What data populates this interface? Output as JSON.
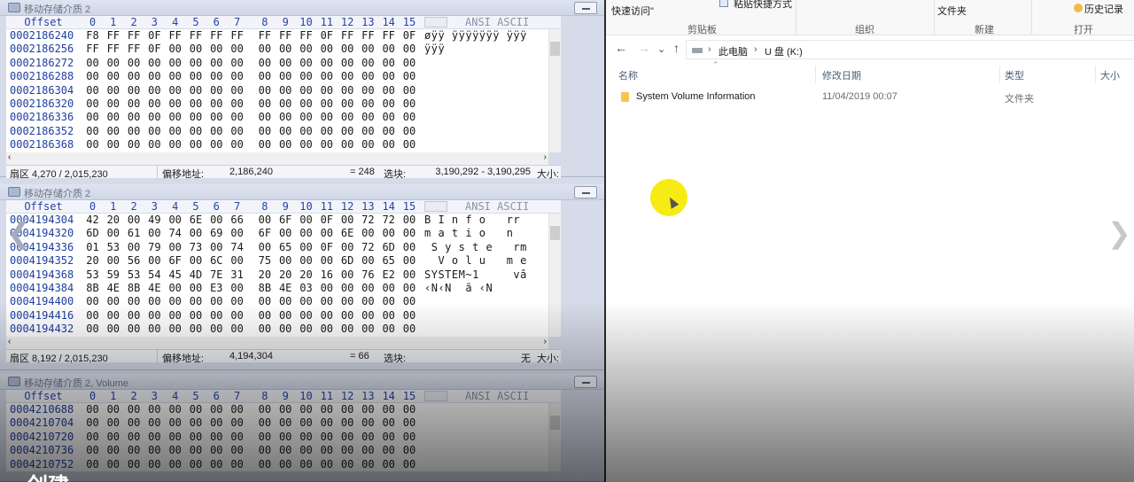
{
  "hex_editor": {
    "columns": [
      "0",
      "1",
      "2",
      "3",
      "4",
      "5",
      "6",
      "7",
      "8",
      "9",
      "10",
      "11",
      "12",
      "13",
      "14",
      "15"
    ],
    "offset_header": "Offset",
    "ascii_header": "ANSI ASCII",
    "panes": [
      {
        "title": "移动存储介质 2",
        "rows": [
          {
            "offset": "0002186240",
            "bytes": [
              "F8",
              "FF",
              "FF",
              "0F",
              "FF",
              "FF",
              "FF",
              "FF",
              "FF",
              "FF",
              "FF",
              "0F",
              "FF",
              "FF",
              "FF",
              "0F"
            ],
            "ascii": "øÿÿ ÿÿÿÿÿÿÿ ÿÿÿ"
          },
          {
            "offset": "0002186256",
            "bytes": [
              "FF",
              "FF",
              "FF",
              "0F",
              "00",
              "00",
              "00",
              "00",
              "00",
              "00",
              "00",
              "00",
              "00",
              "00",
              "00",
              "00"
            ],
            "ascii": "ÿÿÿ"
          },
          {
            "offset": "0002186272",
            "bytes": [
              "00",
              "00",
              "00",
              "00",
              "00",
              "00",
              "00",
              "00",
              "00",
              "00",
              "00",
              "00",
              "00",
              "00",
              "00",
              "00"
            ],
            "ascii": ""
          },
          {
            "offset": "0002186288",
            "bytes": [
              "00",
              "00",
              "00",
              "00",
              "00",
              "00",
              "00",
              "00",
              "00",
              "00",
              "00",
              "00",
              "00",
              "00",
              "00",
              "00"
            ],
            "ascii": ""
          },
          {
            "offset": "0002186304",
            "bytes": [
              "00",
              "00",
              "00",
              "00",
              "00",
              "00",
              "00",
              "00",
              "00",
              "00",
              "00",
              "00",
              "00",
              "00",
              "00",
              "00"
            ],
            "ascii": ""
          },
          {
            "offset": "0002186320",
            "bytes": [
              "00",
              "00",
              "00",
              "00",
              "00",
              "00",
              "00",
              "00",
              "00",
              "00",
              "00",
              "00",
              "00",
              "00",
              "00",
              "00"
            ],
            "ascii": ""
          },
          {
            "offset": "0002186336",
            "bytes": [
              "00",
              "00",
              "00",
              "00",
              "00",
              "00",
              "00",
              "00",
              "00",
              "00",
              "00",
              "00",
              "00",
              "00",
              "00",
              "00"
            ],
            "ascii": ""
          },
          {
            "offset": "0002186352",
            "bytes": [
              "00",
              "00",
              "00",
              "00",
              "00",
              "00",
              "00",
              "00",
              "00",
              "00",
              "00",
              "00",
              "00",
              "00",
              "00",
              "00"
            ],
            "ascii": ""
          },
          {
            "offset": "0002186368",
            "bytes": [
              "00",
              "00",
              "00",
              "00",
              "00",
              "00",
              "00",
              "00",
              "00",
              "00",
              "00",
              "00",
              "00",
              "00",
              "00",
              "00"
            ],
            "ascii": ""
          }
        ],
        "status": {
          "sector": "扇区 4,270 / 2,015,230",
          "offset_label": "偏移地址:",
          "offset_value": "2,186,240",
          "eq": "= 248",
          "sel_label": "选块:",
          "sel_value": "3,190,292 - 3,190,295",
          "size_label": "大小:"
        }
      },
      {
        "title": "移动存储介质 2",
        "rows": [
          {
            "offset": "0004194304",
            "bytes": [
              "42",
              "20",
              "00",
              "49",
              "00",
              "6E",
              "00",
              "66",
              "00",
              "6F",
              "00",
              "0F",
              "00",
              "72",
              "72",
              "00"
            ],
            "ascii": "B I n f o   rr"
          },
          {
            "offset": "0004194320",
            "bytes": [
              "6D",
              "00",
              "61",
              "00",
              "74",
              "00",
              "69",
              "00",
              "6F",
              "00",
              "00",
              "00",
              "6E",
              "00",
              "00",
              "00"
            ],
            "ascii": "m a t i o   n"
          },
          {
            "offset": "0004194336",
            "bytes": [
              "01",
              "53",
              "00",
              "79",
              "00",
              "73",
              "00",
              "74",
              "00",
              "65",
              "00",
              "0F",
              "00",
              "72",
              "6D",
              "00"
            ],
            "ascii": " S y s t e   rm"
          },
          {
            "offset": "0004194352",
            "bytes": [
              "20",
              "00",
              "56",
              "00",
              "6F",
              "00",
              "6C",
              "00",
              "75",
              "00",
              "00",
              "00",
              "6D",
              "00",
              "65",
              "00"
            ],
            "ascii": "  V o l u   m e"
          },
          {
            "offset": "0004194368",
            "bytes": [
              "53",
              "59",
              "53",
              "54",
              "45",
              "4D",
              "7E",
              "31",
              "20",
              "20",
              "20",
              "16",
              "00",
              "76",
              "E2",
              "00"
            ],
            "ascii": "SYSTEM~1     vâ"
          },
          {
            "offset": "0004194384",
            "bytes": [
              "8B",
              "4E",
              "8B",
              "4E",
              "00",
              "00",
              "E3",
              "00",
              "8B",
              "4E",
              "03",
              "00",
              "00",
              "00",
              "00",
              "00"
            ],
            "ascii": "‹N‹N  ã ‹N"
          },
          {
            "offset": "0004194400",
            "bytes": [
              "00",
              "00",
              "00",
              "00",
              "00",
              "00",
              "00",
              "00",
              "00",
              "00",
              "00",
              "00",
              "00",
              "00",
              "00",
              "00"
            ],
            "ascii": ""
          },
          {
            "offset": "0004194416",
            "bytes": [
              "00",
              "00",
              "00",
              "00",
              "00",
              "00",
              "00",
              "00",
              "00",
              "00",
              "00",
              "00",
              "00",
              "00",
              "00",
              "00"
            ],
            "ascii": ""
          },
          {
            "offset": "0004194432",
            "bytes": [
              "00",
              "00",
              "00",
              "00",
              "00",
              "00",
              "00",
              "00",
              "00",
              "00",
              "00",
              "00",
              "00",
              "00",
              "00",
              "00"
            ],
            "ascii": ""
          }
        ],
        "status": {
          "sector": "扇区 8,192 / 2,015,230",
          "offset_label": "偏移地址:",
          "offset_value": "4,194,304",
          "eq": "= 66",
          "sel_label": "选块:",
          "sel_value": "无",
          "size_label": "大小:"
        }
      },
      {
        "title": "移动存储介质 2, Volume",
        "rows": [
          {
            "offset": "0004210688",
            "bytes": [
              "00",
              "00",
              "00",
              "00",
              "00",
              "00",
              "00",
              "00",
              "00",
              "00",
              "00",
              "00",
              "00",
              "00",
              "00",
              "00"
            ],
            "ascii": ""
          },
          {
            "offset": "0004210704",
            "bytes": [
              "00",
              "00",
              "00",
              "00",
              "00",
              "00",
              "00",
              "00",
              "00",
              "00",
              "00",
              "00",
              "00",
              "00",
              "00",
              "00"
            ],
            "ascii": ""
          },
          {
            "offset": "0004210720",
            "bytes": [
              "00",
              "00",
              "00",
              "00",
              "00",
              "00",
              "00",
              "00",
              "00",
              "00",
              "00",
              "00",
              "00",
              "00",
              "00",
              "00"
            ],
            "ascii": ""
          },
          {
            "offset": "0004210736",
            "bytes": [
              "00",
              "00",
              "00",
              "00",
              "00",
              "00",
              "00",
              "00",
              "00",
              "00",
              "00",
              "00",
              "00",
              "00",
              "00",
              "00"
            ],
            "ascii": ""
          },
          {
            "offset": "0004210752",
            "bytes": [
              "00",
              "00",
              "00",
              "00",
              "00",
              "00",
              "00",
              "00",
              "00",
              "00",
              "00",
              "00",
              "00",
              "00",
              "00",
              "00"
            ],
            "ascii": ""
          }
        ]
      }
    ]
  },
  "explorer": {
    "ribbon": {
      "quick_access": "快速访问\"",
      "paste_shortcut": "粘贴快捷方式",
      "folder": "文件夹",
      "history": "历史记录",
      "groups": [
        "剪贴板",
        "组织",
        "新建",
        "打开"
      ]
    },
    "nav": {
      "back": "←",
      "forward": "→",
      "recent": "⌄",
      "up": "↑"
    },
    "breadcrumb": [
      "此电脑",
      "U 盘 (K:)"
    ],
    "columns": {
      "name": "名称",
      "modified": "修改日期",
      "type": "类型",
      "size": "大小"
    },
    "files": [
      {
        "name": "System Volume Information",
        "modified": "11/04/2019 00:07",
        "type": "文件夹"
      }
    ],
    "highlight_color": "#f6ec14"
  },
  "overlay": {
    "subtitle": "创建"
  }
}
